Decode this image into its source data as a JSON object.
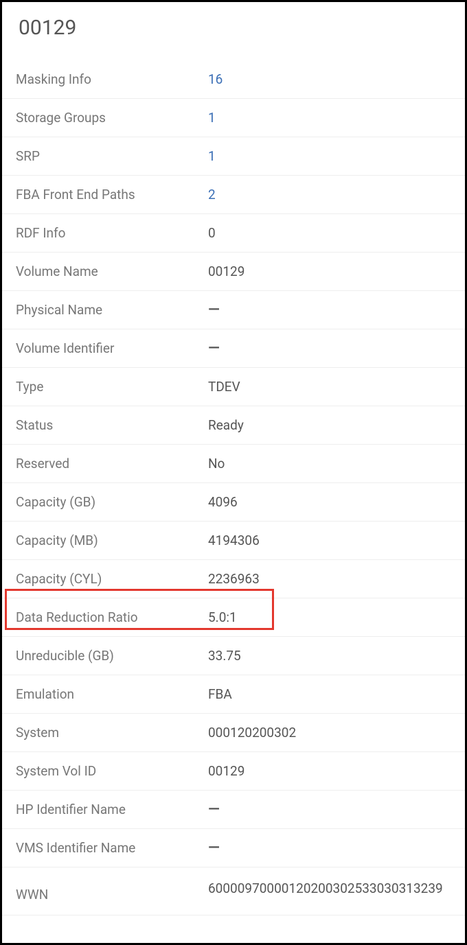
{
  "title": "00129",
  "rows": {
    "masking_info": {
      "label": "Masking Info",
      "value": "16"
    },
    "storage_groups": {
      "label": "Storage Groups",
      "value": "1"
    },
    "srp": {
      "label": "SRP",
      "value": "1"
    },
    "fba_front_end_paths": {
      "label": "FBA Front End Paths",
      "value": "2"
    },
    "rdf_info": {
      "label": "RDF Info",
      "value": "0"
    },
    "volume_name": {
      "label": "Volume Name",
      "value": "00129"
    },
    "physical_name": {
      "label": "Physical Name",
      "value": "—"
    },
    "volume_identifier": {
      "label": "Volume Identifier",
      "value": "—"
    },
    "type": {
      "label": "Type",
      "value": "TDEV"
    },
    "status": {
      "label": "Status",
      "value": "Ready"
    },
    "reserved": {
      "label": "Reserved",
      "value": "No"
    },
    "capacity_gb": {
      "label": "Capacity (GB)",
      "value": "4096"
    },
    "capacity_mb": {
      "label": "Capacity (MB)",
      "value": "4194306"
    },
    "capacity_cyl": {
      "label": "Capacity (CYL)",
      "value": "2236963"
    },
    "data_reduction_ratio": {
      "label": "Data Reduction Ratio",
      "value": "5.0:1"
    },
    "unreducible_gb": {
      "label": "Unreducible (GB)",
      "value": "33.75"
    },
    "emulation": {
      "label": "Emulation",
      "value": "FBA"
    },
    "system": {
      "label": "System",
      "value": "000120200302"
    },
    "system_vol_id": {
      "label": "System Vol ID",
      "value": "00129"
    },
    "hp_identifier_name": {
      "label": "HP Identifier Name",
      "value": "—"
    },
    "vms_identifier_name": {
      "label": "VMS Identifier Name",
      "value": "—"
    },
    "wwn": {
      "label": "WWN",
      "value": "60000970000120200302533030313239"
    }
  }
}
